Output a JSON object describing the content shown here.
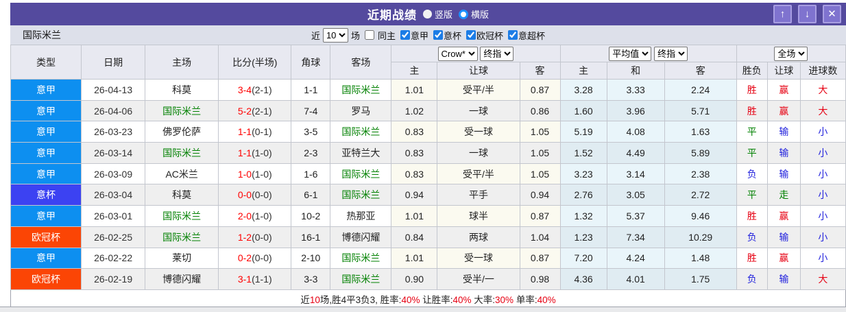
{
  "colors": {
    "league": {
      "意甲": "#0d8ff0",
      "意杯": "#3c42f2",
      "欧冠杯": "#fb4505"
    },
    "outcome": {
      "胜": "#e60012",
      "平": "#008000",
      "负": "#2222dd",
      "赢": "#e60012",
      "走": "#008000",
      "输": "#2222dd",
      "大": "#e60012",
      "小": "#2222dd"
    },
    "team_highlight": "#008000",
    "score_red": "#ff0000",
    "titlebar_bg": "#544a9e"
  },
  "titlebar": {
    "title": "近期战绩",
    "layout_options": [
      {
        "label": "竖版",
        "selected": false
      },
      {
        "label": "横版",
        "selected": true
      }
    ],
    "buttons": {
      "up": "↑",
      "down": "↓",
      "close": "✕"
    }
  },
  "filterbar": {
    "team": "国际米兰",
    "near_label": "近",
    "match_count": "10",
    "count_suffix": "场",
    "same_home": {
      "label": "同主",
      "checked": false
    },
    "leagues": [
      {
        "label": "意甲",
        "checked": true
      },
      {
        "label": "意杯",
        "checked": true
      },
      {
        "label": "欧冠杯",
        "checked": true
      },
      {
        "label": "意超杯",
        "checked": true
      }
    ]
  },
  "table": {
    "main_headers": [
      "类型",
      "日期",
      "主场",
      "比分(半场)",
      "角球",
      "客场"
    ],
    "selects": {
      "crow": "Crow*",
      "crow_final": "终指",
      "avg": "平均值",
      "avg_final": "终指",
      "full": "全场"
    },
    "sub_headers": [
      "主",
      "让球",
      "客",
      "主",
      "和",
      "客",
      "胜负",
      "让球",
      "进球数"
    ],
    "highlight_team": "国际米兰",
    "rows": [
      {
        "league": "意甲",
        "date": "26-04-13",
        "home": "科莫",
        "score": "3-4",
        "half": "(2-1)",
        "corner": "1-1",
        "away": "国际米兰",
        "odds": [
          "1.01",
          "受平/半",
          "0.87"
        ],
        "avg": [
          "3.28",
          "3.33",
          "2.24"
        ],
        "result": "胜",
        "handicap": "赢",
        "goals": "大"
      },
      {
        "league": "意甲",
        "date": "26-04-06",
        "home": "国际米兰",
        "score": "5-2",
        "half": "(2-1)",
        "corner": "7-4",
        "away": "罗马",
        "odds": [
          "1.02",
          "一球",
          "0.86"
        ],
        "avg": [
          "1.60",
          "3.96",
          "5.71"
        ],
        "result": "胜",
        "handicap": "赢",
        "goals": "大"
      },
      {
        "league": "意甲",
        "date": "26-03-23",
        "home": "佛罗伦萨",
        "score": "1-1",
        "half": "(0-1)",
        "corner": "3-5",
        "away": "国际米兰",
        "odds": [
          "0.83",
          "受一球",
          "1.05"
        ],
        "avg": [
          "5.19",
          "4.08",
          "1.63"
        ],
        "result": "平",
        "handicap": "输",
        "goals": "小"
      },
      {
        "league": "意甲",
        "date": "26-03-14",
        "home": "国际米兰",
        "score": "1-1",
        "half": "(1-0)",
        "corner": "2-3",
        "away": "亚特兰大",
        "odds": [
          "0.83",
          "一球",
          "1.05"
        ],
        "avg": [
          "1.52",
          "4.49",
          "5.89"
        ],
        "result": "平",
        "handicap": "输",
        "goals": "小"
      },
      {
        "league": "意甲",
        "date": "26-03-09",
        "home": "AC米兰",
        "score": "1-0",
        "half": "(1-0)",
        "corner": "1-6",
        "away": "国际米兰",
        "odds": [
          "0.83",
          "受平/半",
          "1.05"
        ],
        "avg": [
          "3.23",
          "3.14",
          "2.38"
        ],
        "result": "负",
        "handicap": "输",
        "goals": "小"
      },
      {
        "league": "意杯",
        "date": "26-03-04",
        "home": "科莫",
        "score": "0-0",
        "half": "(0-0)",
        "corner": "6-1",
        "away": "国际米兰",
        "odds": [
          "0.94",
          "平手",
          "0.94"
        ],
        "avg": [
          "2.76",
          "3.05",
          "2.72"
        ],
        "result": "平",
        "handicap": "走",
        "goals": "小"
      },
      {
        "league": "意甲",
        "date": "26-03-01",
        "home": "国际米兰",
        "score": "2-0",
        "half": "(1-0)",
        "corner": "10-2",
        "away": "热那亚",
        "odds": [
          "1.01",
          "球半",
          "0.87"
        ],
        "avg": [
          "1.32",
          "5.37",
          "9.46"
        ],
        "result": "胜",
        "handicap": "赢",
        "goals": "小"
      },
      {
        "league": "欧冠杯",
        "date": "26-02-25",
        "home": "国际米兰",
        "score": "1-2",
        "half": "(0-0)",
        "corner": "16-1",
        "away": "博德闪耀",
        "odds": [
          "0.84",
          "两球",
          "1.04"
        ],
        "avg": [
          "1.23",
          "7.34",
          "10.29"
        ],
        "result": "负",
        "handicap": "输",
        "goals": "小"
      },
      {
        "league": "意甲",
        "date": "26-02-22",
        "home": "莱切",
        "score": "0-2",
        "half": "(0-0)",
        "corner": "2-10",
        "away": "国际米兰",
        "odds": [
          "1.01",
          "受一球",
          "0.87"
        ],
        "avg": [
          "7.20",
          "4.24",
          "1.48"
        ],
        "result": "胜",
        "handicap": "赢",
        "goals": "小"
      },
      {
        "league": "欧冠杯",
        "date": "26-02-19",
        "home": "博德闪耀",
        "score": "3-1",
        "half": "(1-1)",
        "corner": "3-3",
        "away": "国际米兰",
        "odds": [
          "0.90",
          "受半/一",
          "0.98"
        ],
        "avg": [
          "4.36",
          "4.01",
          "1.75"
        ],
        "result": "负",
        "handicap": "输",
        "goals": "大"
      }
    ]
  },
  "footer": {
    "segments": [
      {
        "text": "近"
      },
      {
        "text": "10",
        "red": true
      },
      {
        "text": "场,胜4平3负3, 胜率:"
      },
      {
        "text": "40%",
        "red": true
      },
      {
        "text": " 让胜率:"
      },
      {
        "text": "40%",
        "red": true
      },
      {
        "text": " 大率:"
      },
      {
        "text": "30%",
        "red": true
      },
      {
        "text": " 单率:"
      },
      {
        "text": "40%",
        "red": true
      }
    ]
  }
}
